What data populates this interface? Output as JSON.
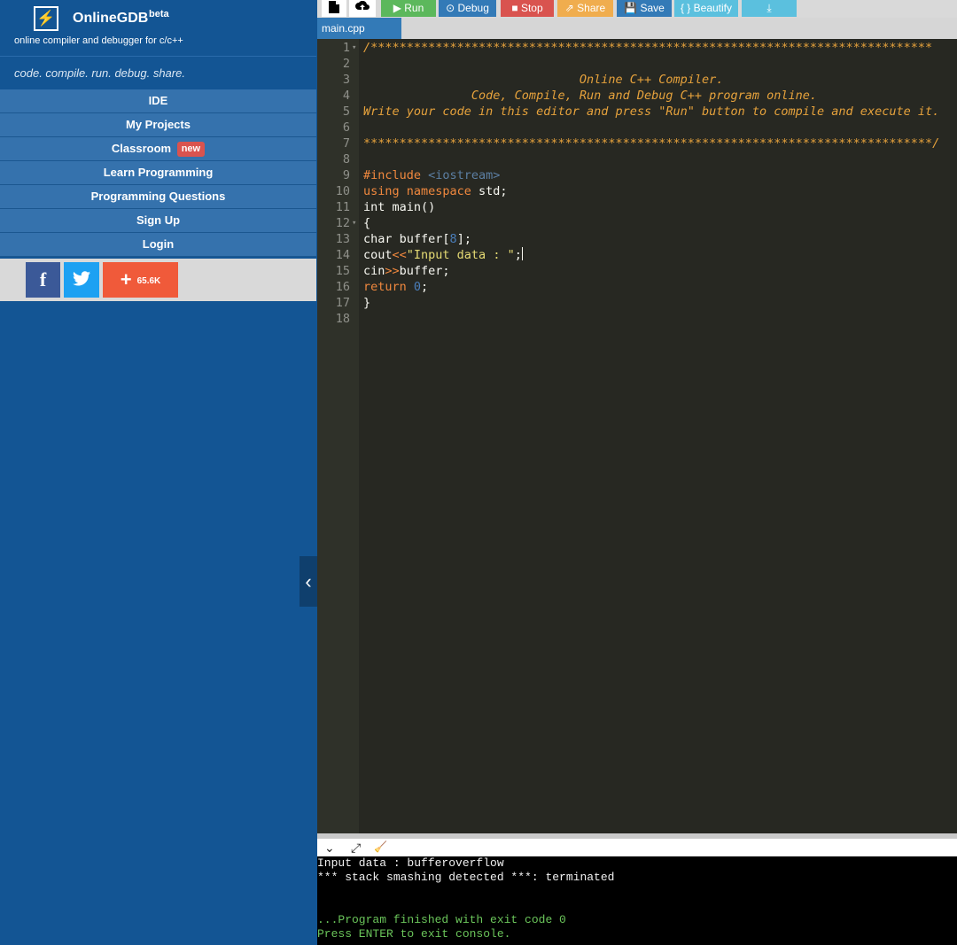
{
  "sidebar": {
    "brand": {
      "logo_glyph": "⚡",
      "name": "OnlineGDB",
      "beta": "beta",
      "subtitle": "online compiler and debugger for c/c++"
    },
    "tagline": "code. compile. run. debug. share.",
    "nav": [
      {
        "label": "IDE"
      },
      {
        "label": "My Projects"
      },
      {
        "label": "Classroom",
        "badge": "new"
      },
      {
        "label": "Learn Programming"
      },
      {
        "label": "Programming Questions"
      },
      {
        "label": "Sign Up"
      },
      {
        "label": "Login"
      }
    ],
    "social": {
      "facebook_glyph": "f",
      "twitter_glyph": "🐦",
      "share_count": "65.6K"
    },
    "collapse_glyph": "‹"
  },
  "toolbar": {
    "new_file_glyph": "🗋",
    "upload_glyph": "⇪",
    "run_label": "▶ Run",
    "debug_label": "⊙ Debug",
    "stop_label": "■ Stop",
    "share_label": "⇗ Share",
    "save_label": "💾 Save",
    "beautify_label": "{ } Beautify",
    "download_glyph": "⤓"
  },
  "editor": {
    "tab": "main.cpp",
    "line_numbers": [
      "1",
      "2",
      "3",
      "4",
      "5",
      "6",
      "7",
      "8",
      "9",
      "10",
      "11",
      "12",
      "13",
      "14",
      "15",
      "16",
      "17",
      "18"
    ],
    "code": {
      "l1": "/******************************************************************************",
      "l3": "                              Online C++ Compiler.",
      "l4": "               Code, Compile, Run and Debug C++ program online.",
      "l5": "Write your code in this editor and press \"Run\" button to compile and execute it.",
      "l7": "*******************************************************************************/",
      "l9_kw": "#include ",
      "l9_inc": "<iostream>",
      "l10_kw": "using namespace ",
      "l10_rest": "std;",
      "l11": "int main()",
      "l12": "{",
      "l13_a": "char buffer[",
      "l13_num": "8",
      "l13_b": "];",
      "l14_a": "cout",
      "l14_op": "<<",
      "l14_str": "\"Input data : \"",
      "l14_b": ";",
      "l15_a": "cin",
      "l15_op": ">>",
      "l15_b": "buffer;",
      "l16_kw": "return ",
      "l16_num": "0",
      "l16_b": ";",
      "l17": "}"
    }
  },
  "console_bar": {
    "collapse_glyph": "⌄",
    "expand_glyph": "⤢",
    "clear_glyph": "🧹"
  },
  "console": {
    "lines": [
      "Input data : bufferoverflow",
      "*** stack smashing detected ***: terminated",
      "",
      "",
      "...Program finished with exit code 0",
      "Press ENTER to exit console."
    ]
  }
}
